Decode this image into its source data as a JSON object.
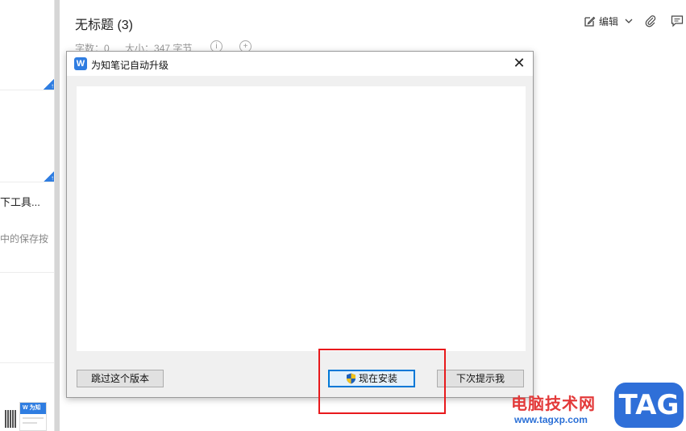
{
  "note_list": {
    "item_title": "下工具...",
    "item_snippet": "中的保存按",
    "corner_tag": "↑",
    "thumb_card_text": "W 为知"
  },
  "note": {
    "title": "无标题 (3)",
    "word_count": "字数：0",
    "size": "大小：347 字节",
    "info_icon": "i",
    "add_icon": "+"
  },
  "toolbar": {
    "edit_label": "编辑",
    "icons": [
      "edit-icon",
      "chevron-down-icon",
      "attachment-icon",
      "comment-icon"
    ]
  },
  "dialog": {
    "title": "为知笔记自动升级",
    "close": "✕",
    "logo": "W",
    "buttons": {
      "skip": "跳过这个版本",
      "install": "现在安装",
      "later": "下次提示我"
    }
  },
  "watermark": {
    "site_name": "电脑技术网",
    "url": "www.tagxp.com",
    "tag": "TAG"
  },
  "colors": {
    "accent": "#2f7de1",
    "highlight": "#e8191c",
    "install_border": "#0078d7"
  }
}
